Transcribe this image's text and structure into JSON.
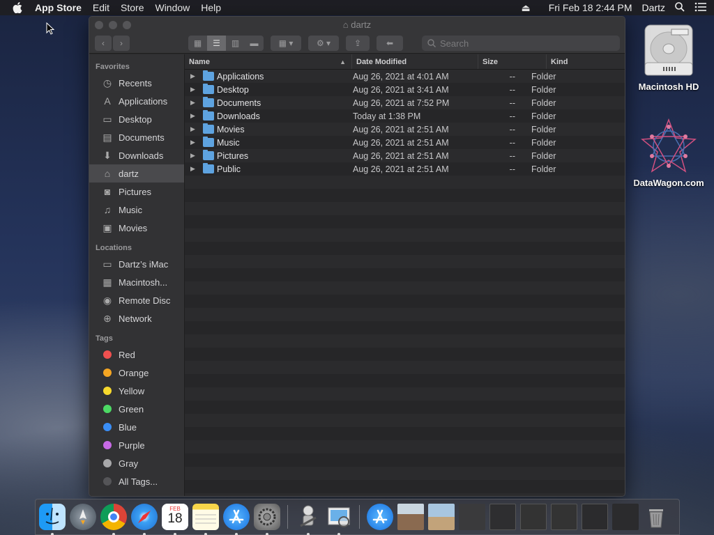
{
  "menubar": {
    "app_name": "App Store",
    "menus": [
      "Edit",
      "Store",
      "Window",
      "Help"
    ],
    "datetime": "Fri Feb 18  2:44 PM",
    "user": "Dartz"
  },
  "desktop": {
    "icons": [
      {
        "label": "Macintosh HD",
        "icon": "hard-drive-icon"
      },
      {
        "label": "DataWagon.com",
        "icon": "geometric-star-icon"
      }
    ]
  },
  "window": {
    "title": "dartz",
    "search_placeholder": "Search",
    "columns": {
      "name": "Name",
      "date": "Date Modified",
      "size": "Size",
      "kind": "Kind"
    },
    "rows": [
      {
        "name": "Applications",
        "date": "Aug 26, 2021 at 4:01 AM",
        "size": "--",
        "kind": "Folder"
      },
      {
        "name": "Desktop",
        "date": "Aug 26, 2021 at 3:41 AM",
        "size": "--",
        "kind": "Folder"
      },
      {
        "name": "Documents",
        "date": "Aug 26, 2021 at 7:52 PM",
        "size": "--",
        "kind": "Folder"
      },
      {
        "name": "Downloads",
        "date": "Today at 1:38 PM",
        "size": "--",
        "kind": "Folder"
      },
      {
        "name": "Movies",
        "date": "Aug 26, 2021 at 2:51 AM",
        "size": "--",
        "kind": "Folder"
      },
      {
        "name": "Music",
        "date": "Aug 26, 2021 at 2:51 AM",
        "size": "--",
        "kind": "Folder"
      },
      {
        "name": "Pictures",
        "date": "Aug 26, 2021 at 2:51 AM",
        "size": "--",
        "kind": "Folder"
      },
      {
        "name": "Public",
        "date": "Aug 26, 2021 at 2:51 AM",
        "size": "--",
        "kind": "Folder"
      }
    ]
  },
  "sidebar": {
    "favorites_header": "Favorites",
    "favorites": [
      {
        "label": "Recents",
        "icon": "clock-icon"
      },
      {
        "label": "Applications",
        "icon": "applications-icon"
      },
      {
        "label": "Desktop",
        "icon": "desktop-icon"
      },
      {
        "label": "Documents",
        "icon": "document-icon"
      },
      {
        "label": "Downloads",
        "icon": "download-icon"
      },
      {
        "label": "dartz",
        "icon": "home-icon",
        "selected": true
      },
      {
        "label": "Pictures",
        "icon": "camera-icon"
      },
      {
        "label": "Music",
        "icon": "music-note-icon"
      },
      {
        "label": "Movies",
        "icon": "film-icon"
      }
    ],
    "locations_header": "Locations",
    "locations": [
      {
        "label": "Dartz’s iMac",
        "icon": "imac-icon"
      },
      {
        "label": "Macintosh...",
        "icon": "disk-icon"
      },
      {
        "label": "Remote Disc",
        "icon": "optical-disc-icon"
      },
      {
        "label": "Network",
        "icon": "globe-icon"
      }
    ],
    "tags_header": "Tags",
    "tags": [
      {
        "label": "Red",
        "color": "#f0504f"
      },
      {
        "label": "Orange",
        "color": "#f5a623"
      },
      {
        "label": "Yellow",
        "color": "#f7d92d"
      },
      {
        "label": "Green",
        "color": "#4cd964"
      },
      {
        "label": "Blue",
        "color": "#3a8ef6"
      },
      {
        "label": "Purple",
        "color": "#c86ae6"
      },
      {
        "label": "Gray",
        "color": "#a8a8aa"
      },
      {
        "label": "All Tags...",
        "color": "#555558"
      }
    ]
  },
  "dock": {
    "apps": [
      "finder-icon",
      "launchpad-icon",
      "chrome-icon",
      "safari-icon",
      "calendar-icon",
      "notes-icon",
      "app-store-icon",
      "system-preferences-icon",
      "automator-icon",
      "preview-icon",
      "app-store-icon",
      "photo-thumbnail-icon",
      "photo-thumbnail-icon",
      "window-thumbnail-icon",
      "window-thumbnail-icon",
      "window-thumbnail-icon",
      "window-thumbnail-icon",
      "window-thumbnail-icon",
      "window-thumbnail-icon",
      "trash-icon"
    ],
    "calendar_month": "FEB",
    "calendar_day": "18"
  }
}
